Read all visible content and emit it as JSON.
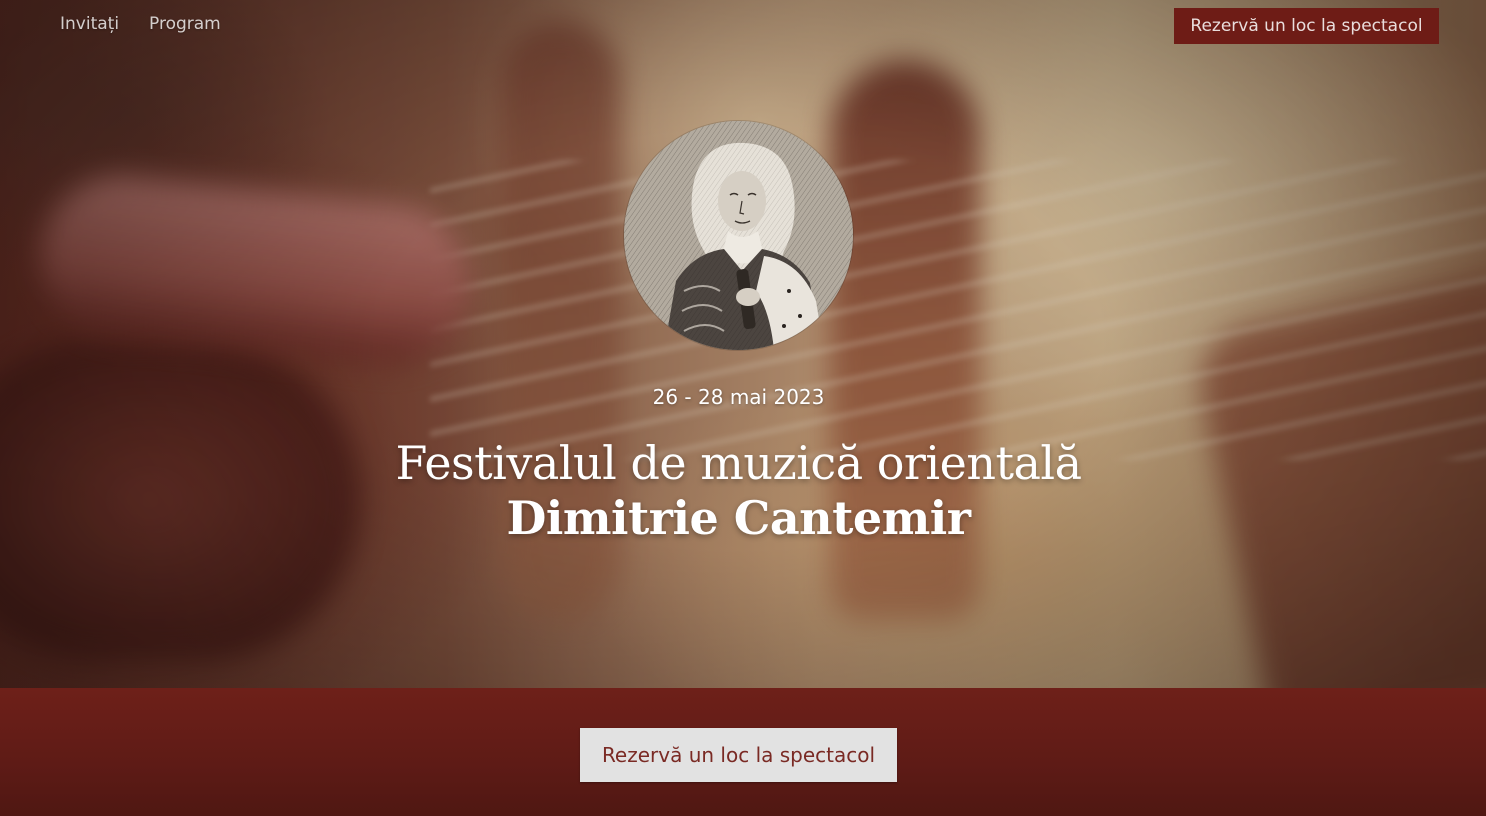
{
  "nav": {
    "links": [
      {
        "label": "Invitați"
      },
      {
        "label": "Program"
      }
    ],
    "cta_label": "Rezervă un loc la spectacol"
  },
  "hero": {
    "portrait_icon": "portrait-engraving",
    "date": "26 - 28 mai 2023",
    "title_line1": "Festivalul de muzică orientală",
    "title_line2": "Dimitrie Cantemir"
  },
  "band": {
    "cta_label": "Rezervă un loc la spectacol"
  },
  "colors": {
    "accent": "#6e1c16",
    "band": "#5e1b16",
    "button_light": "#e2e2e2",
    "button_text": "#7a2a24"
  }
}
